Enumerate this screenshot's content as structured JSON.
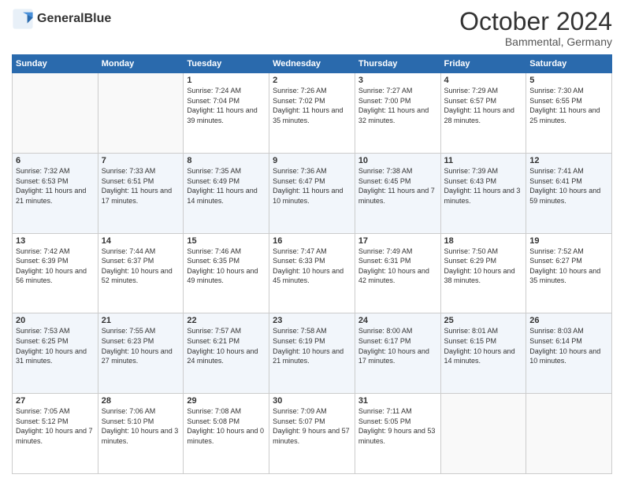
{
  "header": {
    "logo": "GeneralBlue",
    "month": "October 2024",
    "location": "Bammental, Germany"
  },
  "days_of_week": [
    "Sunday",
    "Monday",
    "Tuesday",
    "Wednesday",
    "Thursday",
    "Friday",
    "Saturday"
  ],
  "weeks": [
    [
      {
        "day": "",
        "empty": true
      },
      {
        "day": "",
        "empty": true
      },
      {
        "day": "1",
        "sunrise": "Sunrise: 7:24 AM",
        "sunset": "Sunset: 7:04 PM",
        "daylight": "Daylight: 11 hours and 39 minutes."
      },
      {
        "day": "2",
        "sunrise": "Sunrise: 7:26 AM",
        "sunset": "Sunset: 7:02 PM",
        "daylight": "Daylight: 11 hours and 35 minutes."
      },
      {
        "day": "3",
        "sunrise": "Sunrise: 7:27 AM",
        "sunset": "Sunset: 7:00 PM",
        "daylight": "Daylight: 11 hours and 32 minutes."
      },
      {
        "day": "4",
        "sunrise": "Sunrise: 7:29 AM",
        "sunset": "Sunset: 6:57 PM",
        "daylight": "Daylight: 11 hours and 28 minutes."
      },
      {
        "day": "5",
        "sunrise": "Sunrise: 7:30 AM",
        "sunset": "Sunset: 6:55 PM",
        "daylight": "Daylight: 11 hours and 25 minutes."
      }
    ],
    [
      {
        "day": "6",
        "sunrise": "Sunrise: 7:32 AM",
        "sunset": "Sunset: 6:53 PM",
        "daylight": "Daylight: 11 hours and 21 minutes."
      },
      {
        "day": "7",
        "sunrise": "Sunrise: 7:33 AM",
        "sunset": "Sunset: 6:51 PM",
        "daylight": "Daylight: 11 hours and 17 minutes."
      },
      {
        "day": "8",
        "sunrise": "Sunrise: 7:35 AM",
        "sunset": "Sunset: 6:49 PM",
        "daylight": "Daylight: 11 hours and 14 minutes."
      },
      {
        "day": "9",
        "sunrise": "Sunrise: 7:36 AM",
        "sunset": "Sunset: 6:47 PM",
        "daylight": "Daylight: 11 hours and 10 minutes."
      },
      {
        "day": "10",
        "sunrise": "Sunrise: 7:38 AM",
        "sunset": "Sunset: 6:45 PM",
        "daylight": "Daylight: 11 hours and 7 minutes."
      },
      {
        "day": "11",
        "sunrise": "Sunrise: 7:39 AM",
        "sunset": "Sunset: 6:43 PM",
        "daylight": "Daylight: 11 hours and 3 minutes."
      },
      {
        "day": "12",
        "sunrise": "Sunrise: 7:41 AM",
        "sunset": "Sunset: 6:41 PM",
        "daylight": "Daylight: 10 hours and 59 minutes."
      }
    ],
    [
      {
        "day": "13",
        "sunrise": "Sunrise: 7:42 AM",
        "sunset": "Sunset: 6:39 PM",
        "daylight": "Daylight: 10 hours and 56 minutes."
      },
      {
        "day": "14",
        "sunrise": "Sunrise: 7:44 AM",
        "sunset": "Sunset: 6:37 PM",
        "daylight": "Daylight: 10 hours and 52 minutes."
      },
      {
        "day": "15",
        "sunrise": "Sunrise: 7:46 AM",
        "sunset": "Sunset: 6:35 PM",
        "daylight": "Daylight: 10 hours and 49 minutes."
      },
      {
        "day": "16",
        "sunrise": "Sunrise: 7:47 AM",
        "sunset": "Sunset: 6:33 PM",
        "daylight": "Daylight: 10 hours and 45 minutes."
      },
      {
        "day": "17",
        "sunrise": "Sunrise: 7:49 AM",
        "sunset": "Sunset: 6:31 PM",
        "daylight": "Daylight: 10 hours and 42 minutes."
      },
      {
        "day": "18",
        "sunrise": "Sunrise: 7:50 AM",
        "sunset": "Sunset: 6:29 PM",
        "daylight": "Daylight: 10 hours and 38 minutes."
      },
      {
        "day": "19",
        "sunrise": "Sunrise: 7:52 AM",
        "sunset": "Sunset: 6:27 PM",
        "daylight": "Daylight: 10 hours and 35 minutes."
      }
    ],
    [
      {
        "day": "20",
        "sunrise": "Sunrise: 7:53 AM",
        "sunset": "Sunset: 6:25 PM",
        "daylight": "Daylight: 10 hours and 31 minutes."
      },
      {
        "day": "21",
        "sunrise": "Sunrise: 7:55 AM",
        "sunset": "Sunset: 6:23 PM",
        "daylight": "Daylight: 10 hours and 27 minutes."
      },
      {
        "day": "22",
        "sunrise": "Sunrise: 7:57 AM",
        "sunset": "Sunset: 6:21 PM",
        "daylight": "Daylight: 10 hours and 24 minutes."
      },
      {
        "day": "23",
        "sunrise": "Sunrise: 7:58 AM",
        "sunset": "Sunset: 6:19 PM",
        "daylight": "Daylight: 10 hours and 21 minutes."
      },
      {
        "day": "24",
        "sunrise": "Sunrise: 8:00 AM",
        "sunset": "Sunset: 6:17 PM",
        "daylight": "Daylight: 10 hours and 17 minutes."
      },
      {
        "day": "25",
        "sunrise": "Sunrise: 8:01 AM",
        "sunset": "Sunset: 6:15 PM",
        "daylight": "Daylight: 10 hours and 14 minutes."
      },
      {
        "day": "26",
        "sunrise": "Sunrise: 8:03 AM",
        "sunset": "Sunset: 6:14 PM",
        "daylight": "Daylight: 10 hours and 10 minutes."
      }
    ],
    [
      {
        "day": "27",
        "sunrise": "Sunrise: 7:05 AM",
        "sunset": "Sunset: 5:12 PM",
        "daylight": "Daylight: 10 hours and 7 minutes."
      },
      {
        "day": "28",
        "sunrise": "Sunrise: 7:06 AM",
        "sunset": "Sunset: 5:10 PM",
        "daylight": "Daylight: 10 hours and 3 minutes."
      },
      {
        "day": "29",
        "sunrise": "Sunrise: 7:08 AM",
        "sunset": "Sunset: 5:08 PM",
        "daylight": "Daylight: 10 hours and 0 minutes."
      },
      {
        "day": "30",
        "sunrise": "Sunrise: 7:09 AM",
        "sunset": "Sunset: 5:07 PM",
        "daylight": "Daylight: 9 hours and 57 minutes."
      },
      {
        "day": "31",
        "sunrise": "Sunrise: 7:11 AM",
        "sunset": "Sunset: 5:05 PM",
        "daylight": "Daylight: 9 hours and 53 minutes."
      },
      {
        "day": "",
        "empty": true
      },
      {
        "day": "",
        "empty": true
      }
    ]
  ]
}
